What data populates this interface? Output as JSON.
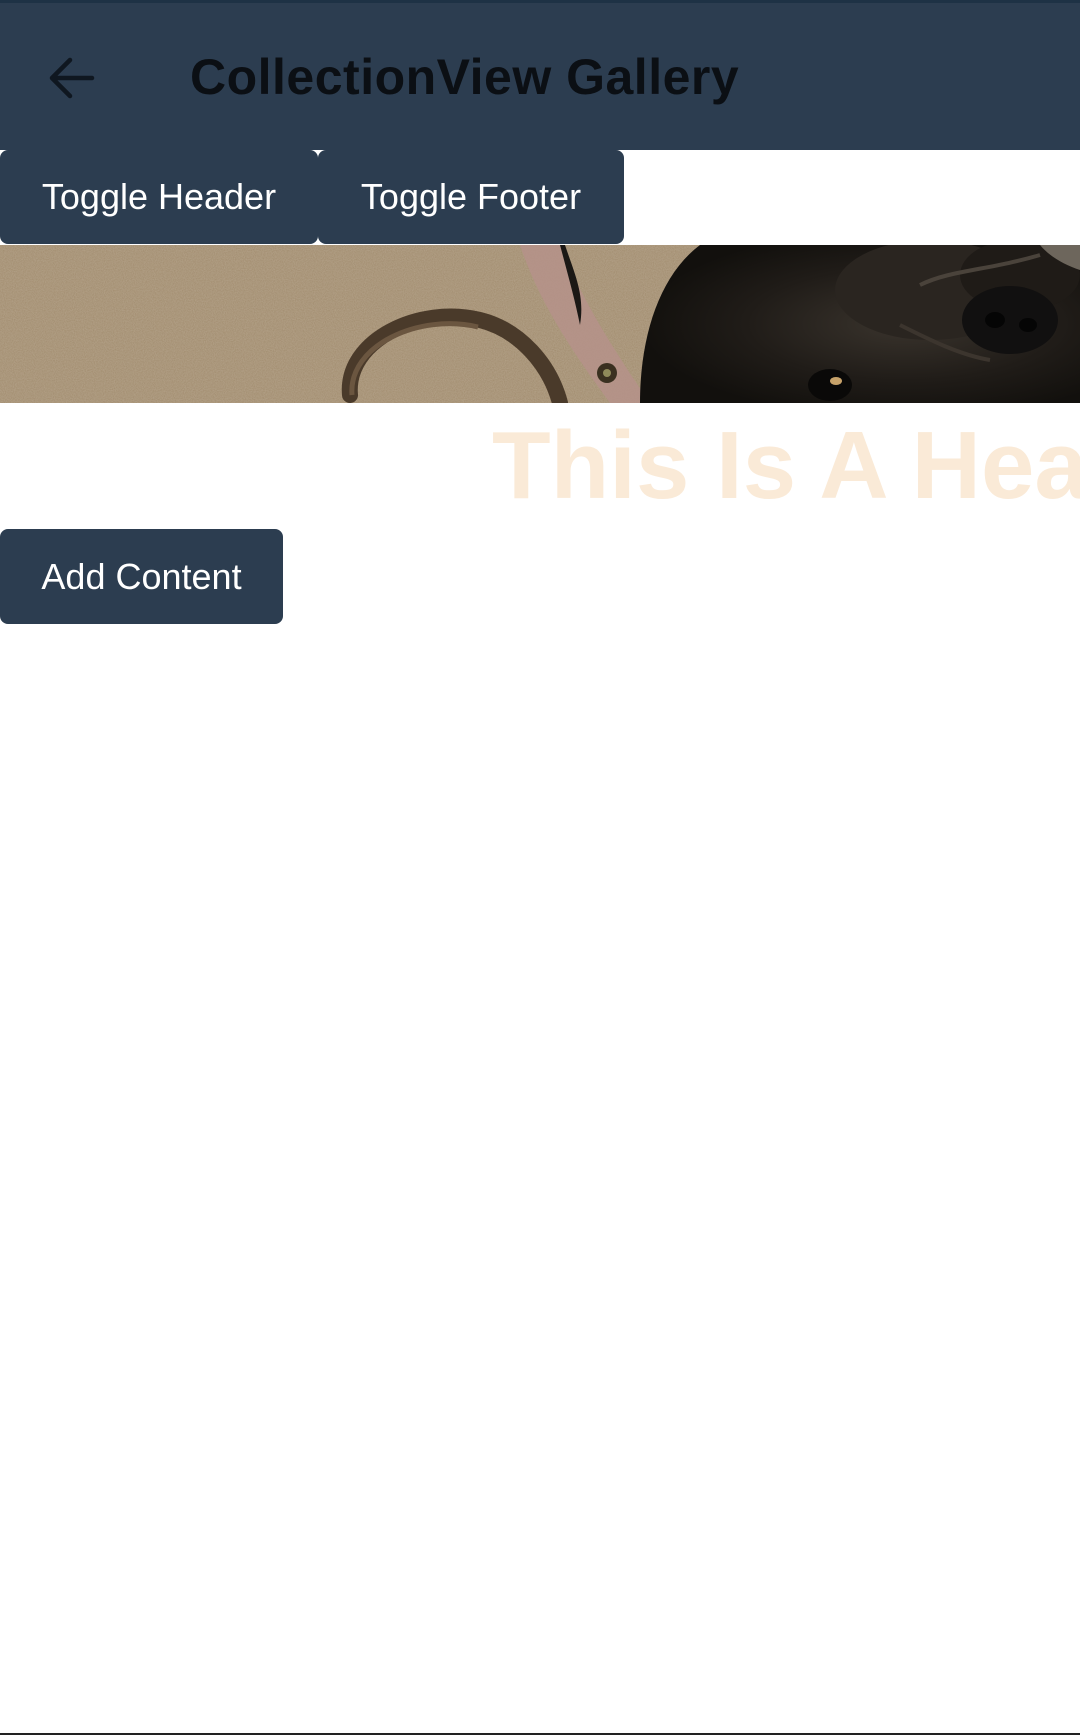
{
  "toolbar": {
    "title": "CollectionView Gallery",
    "back_icon": "arrow-left-icon"
  },
  "buttons": {
    "toggle_header": "Toggle Header",
    "toggle_footer": "Toggle Footer",
    "add_content": "Add Content"
  },
  "header": {
    "text": "This Is A Header"
  },
  "colors": {
    "toolbar_bg": "#2c3d50",
    "button_bg": "#2c3d50",
    "header_text": "#faead7",
    "title_text": "#0b0f14"
  }
}
